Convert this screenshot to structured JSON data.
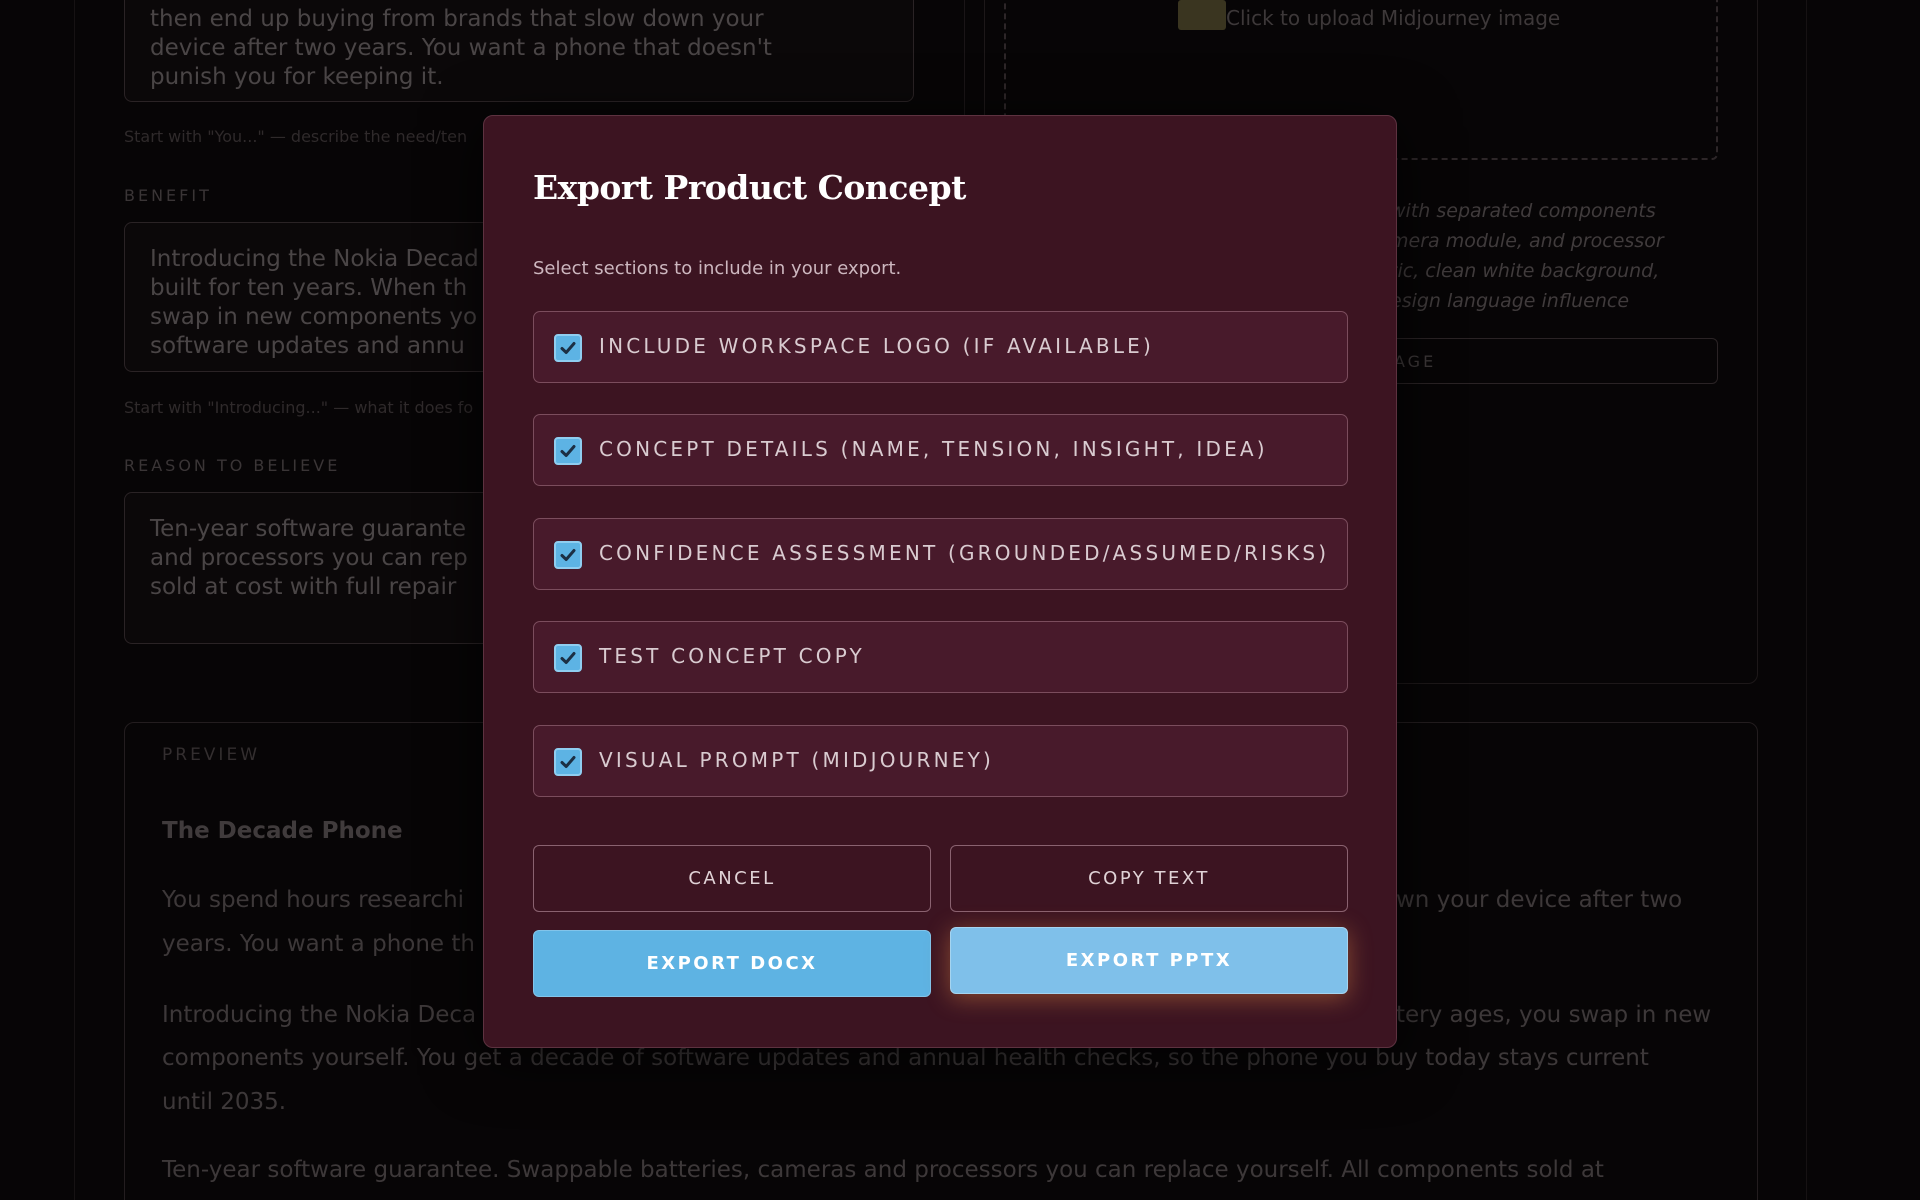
{
  "background": {
    "need_text": "then end up buying from brands that slow down your\ndevice after two years. You want a phone that doesn't\npunish you for keeping it.",
    "need_hint": "Start with \"You...\" — describe the need/ten",
    "benefit_label": "BENEFIT",
    "benefit_text": "Introducing the Nokia Decad\nbuilt for ten years. When th\nswap in new components yo\nsoftware updates and annu",
    "benefit_hint": "Start with \"Introducing...\" — what it does fo",
    "rtb_label": "REASON TO BELIEVE",
    "rtb_text": "Ten-year software guarante\nand processors you can rep\nsold at cost with full repair",
    "upload_text": "Click to upload Midjourney image",
    "prompt_text": "with separated components\nmera module, and processor\ntic, clean white background,\nesign language influence",
    "gen_button_label": "AGE",
    "preview_label": "PREVIEW",
    "preview_title": "The Decade Phone",
    "preview_para1_left": "You spend hours researchi",
    "preview_para1_right": "wn your device after two",
    "preview_para1_line2": "years. You want a phone th",
    "preview_para2_left": "Introducing the Nokia Deca",
    "preview_para2_right": "tery ages, you swap in new",
    "preview_para2_line2": "components yourself. You get a decade of software updates and annual health checks, so the phone you buy today stays current",
    "preview_para2_line3": "until 2035.",
    "preview_para3": "Ten-year software guarantee. Swappable batteries, cameras and processors you can replace yourself. All components sold at"
  },
  "modal": {
    "title": "Export Product Concept",
    "subtitle": "Select sections to include in your export.",
    "options": [
      {
        "label": "Include workspace logo (if available)",
        "checked": true
      },
      {
        "label": "Concept details (name, tension, insight, idea)",
        "checked": true
      },
      {
        "label": "Confidence assessment (grounded/assumed/risks)",
        "checked": true
      },
      {
        "label": "Test concept copy",
        "checked": true
      },
      {
        "label": "Visual prompt (Midjourney)",
        "checked": true
      }
    ],
    "cancel_label": "CANCEL",
    "copy_label": "COPY TEXT",
    "export_docx_label": "EXPORT DOCX",
    "export_pptx_label": "EXPORT PPTX"
  },
  "colors": {
    "modal_bg": "#3c1421",
    "option_bg": "#481a2b",
    "accent": "#5eb3e3"
  }
}
